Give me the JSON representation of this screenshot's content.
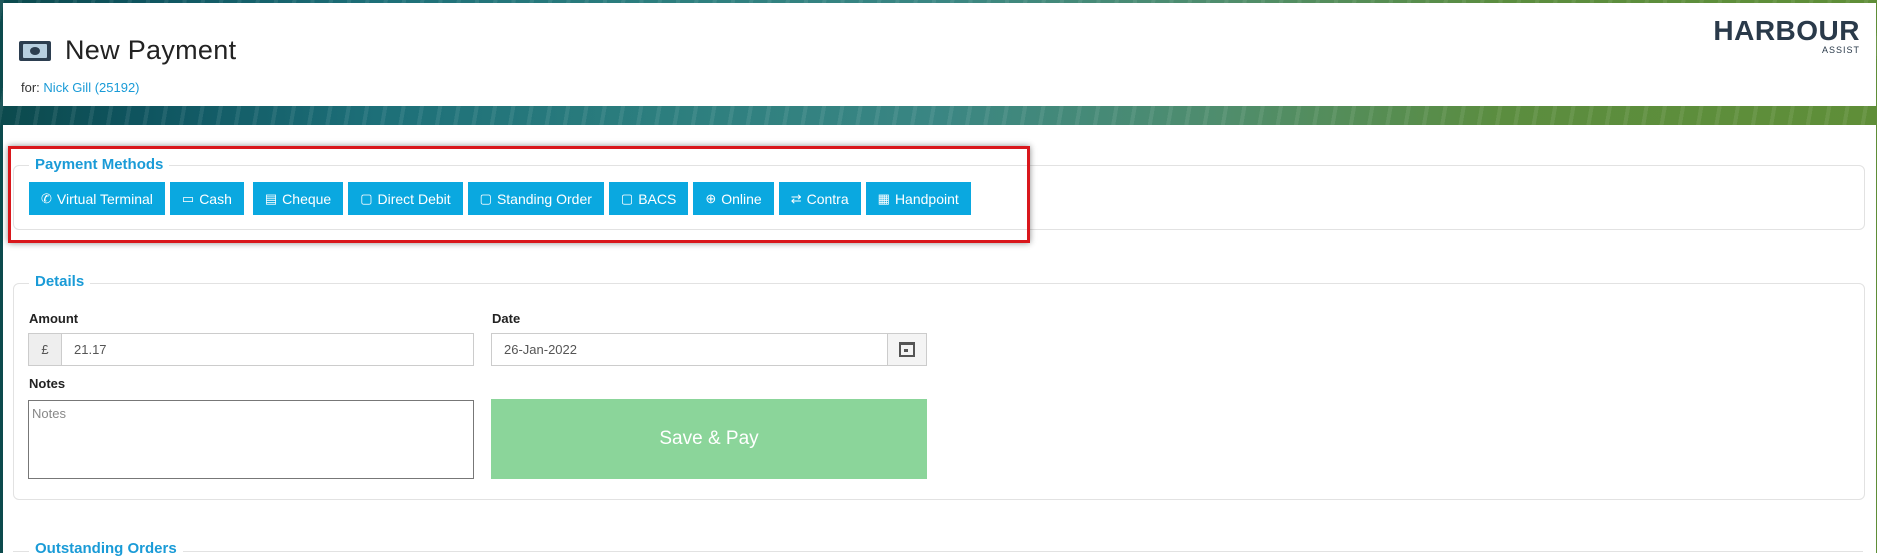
{
  "header": {
    "title": "New Payment",
    "for_label": "for:",
    "customer": "Nick Gill (25192)",
    "logo_main": "HARBOUR",
    "logo_sub": "ASSIST"
  },
  "payment_methods": {
    "legend": "Payment Methods",
    "buttons": [
      {
        "label": "Virtual Terminal",
        "icon": "phone-icon"
      },
      {
        "label": "Cash",
        "icon": "money-icon"
      },
      {
        "label": "Cheque",
        "icon": "cheque-icon"
      },
      {
        "label": "Direct Debit",
        "icon": "calendar-icon"
      },
      {
        "label": "Standing Order",
        "icon": "calendar-icon"
      },
      {
        "label": "BACS",
        "icon": "calendar-icon"
      },
      {
        "label": "Online",
        "icon": "globe-icon"
      },
      {
        "label": "Contra",
        "icon": "exchange-icon"
      },
      {
        "label": "Handpoint",
        "icon": "calculator-icon"
      }
    ]
  },
  "details": {
    "legend": "Details",
    "amount_label": "Amount",
    "currency": "£",
    "amount_value": "21.17",
    "date_label": "Date",
    "date_value": "26-Jan-2022",
    "notes_label": "Notes",
    "notes_placeholder": "Notes",
    "save_label": "Save & Pay"
  },
  "outstanding": {
    "legend": "Outstanding Orders"
  },
  "colors": {
    "accent": "#0aa8e0",
    "link": "#1a9bd7",
    "save": "#8bd59a",
    "highlight": "#d9171c"
  }
}
